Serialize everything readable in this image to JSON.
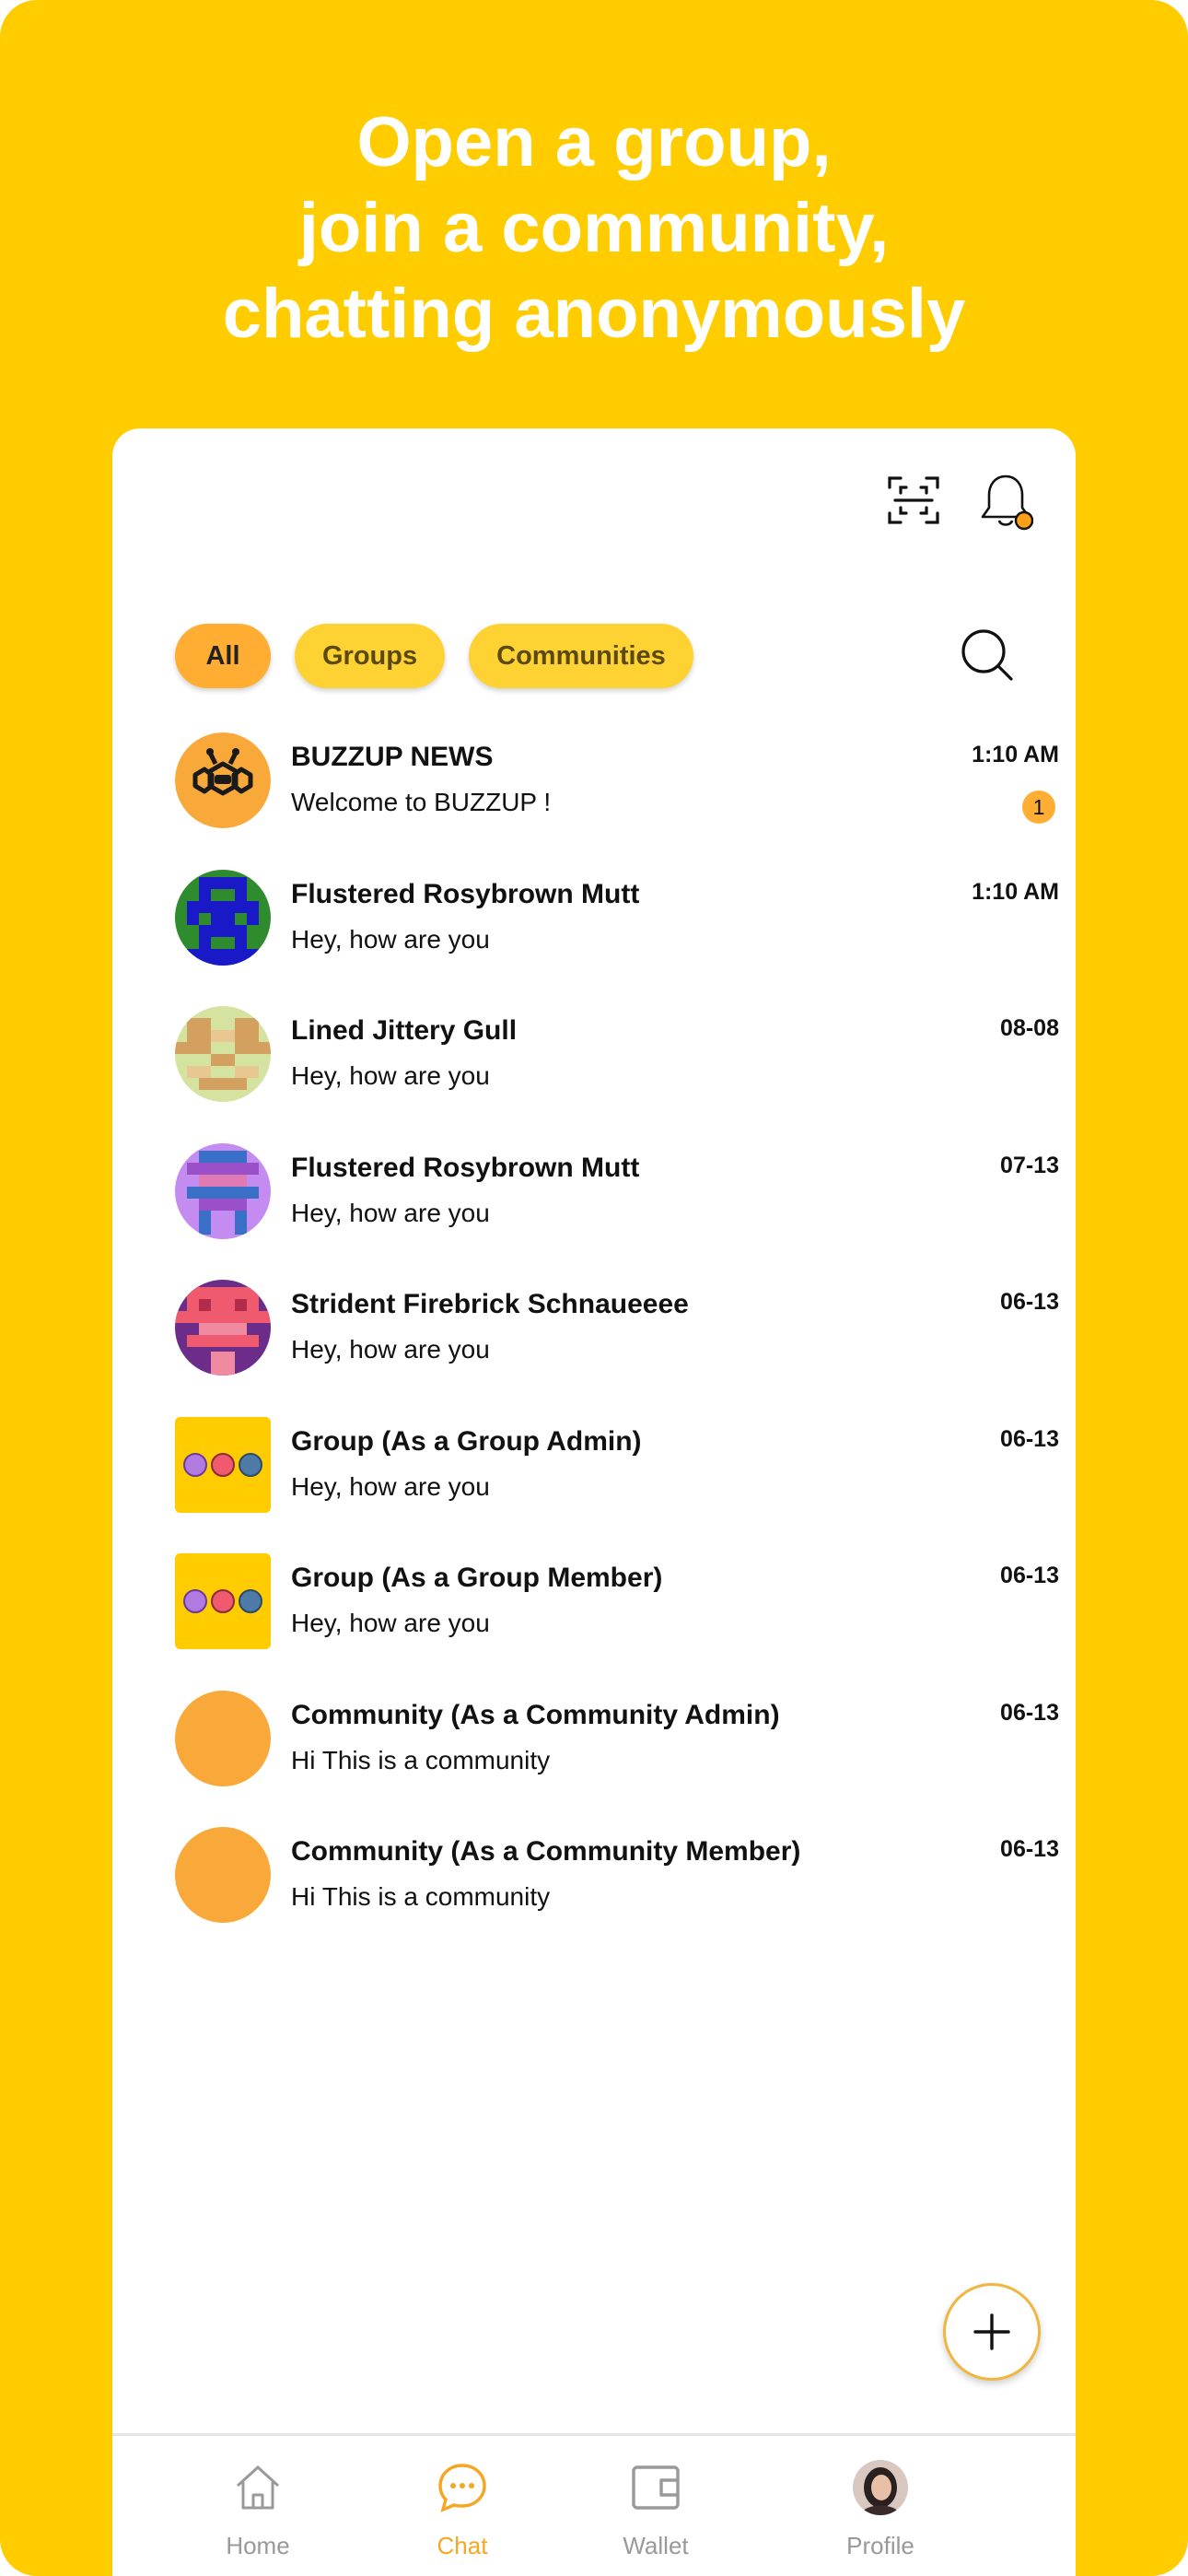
{
  "headline": {
    "line1": "Open a group,",
    "line2": "join a community,",
    "line3": "chatting anonymously"
  },
  "colors": {
    "brand_yellow": "#FFCC00",
    "accent_orange": "#FFAE33",
    "chip_yellow": "#FFD233",
    "active_tab": "#F5A623"
  },
  "toolbar": {
    "scan_icon": "scan-icon",
    "notifications_icon": "bell-icon",
    "notification_dot": true
  },
  "filters": {
    "all": "All",
    "groups": "Groups",
    "communities": "Communities",
    "selected": "All"
  },
  "chats": [
    {
      "name": "BUZZUP NEWS",
      "message": "Welcome to BUZZUP !",
      "time": "1:10 AM",
      "unread": "1"
    },
    {
      "name": "Flustered Rosybrown Mutt",
      "message": "Hey, how are you",
      "time": "1:10 AM"
    },
    {
      "name": "Lined Jittery Gull",
      "message": "Hey, how are you",
      "time": "08-08"
    },
    {
      "name": "Flustered Rosybrown Mutt",
      "message": "Hey, how are you",
      "time": "07-13"
    },
    {
      "name": "Strident Firebrick Schnaueeee",
      "message": "Hey, how are you",
      "time": "06-13"
    },
    {
      "name": "Group (As a Group Admin)",
      "message": "Hey, how are you",
      "time": "06-13"
    },
    {
      "name": "Group (As a Group Member)",
      "message": "Hey, how are you",
      "time": "06-13"
    },
    {
      "name": "Community (As a Community Admin)",
      "message": "Hi This is a community",
      "time": "06-13"
    },
    {
      "name": "Community (As a Community Member)",
      "message": "Hi This is a community",
      "time": "06-13"
    }
  ],
  "tabs": {
    "home": "Home",
    "chat": "Chat",
    "wallet": "Wallet",
    "profile": "Profile",
    "selected": "Chat"
  }
}
